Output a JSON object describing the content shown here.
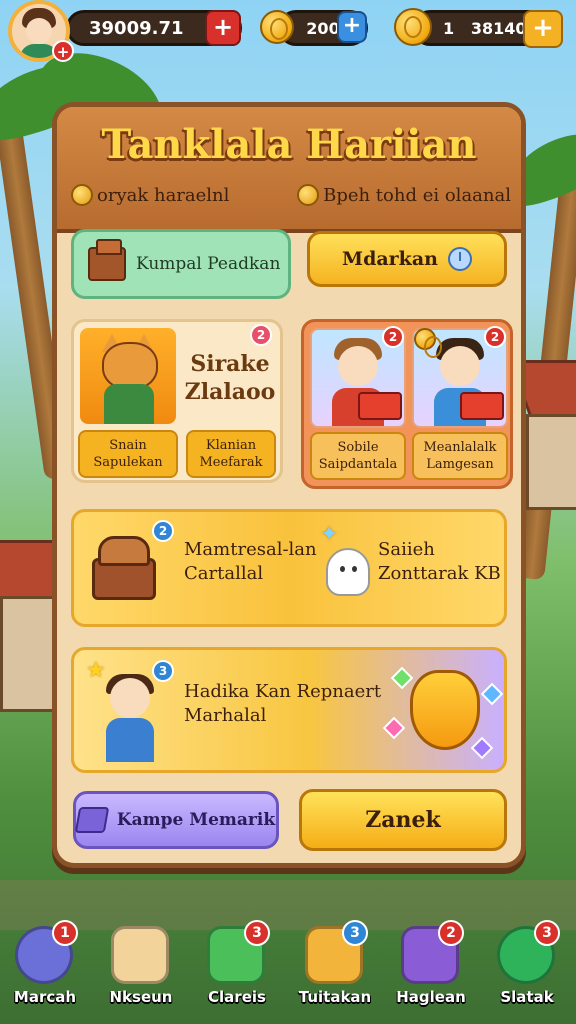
{
  "top_bar": {
    "player_value": "39009.71",
    "mid_currency": "200",
    "right_currency": "1   38140"
  },
  "panel": {
    "title": "Tanklala Hariian",
    "subtitle_left": "oryak haraelnl",
    "subtitle_right": "Bpeh tohd ei olaanal",
    "left_button": "Kumpal Peadkan",
    "right_button": "Mdarkan",
    "card_left": {
      "title_line1": "Sirake",
      "title_line2": "Zlalaoo",
      "badge": "2",
      "chip1_line1": "Snain",
      "chip1_line2": "Sapulekan",
      "chip2_line1": "Klanian",
      "chip2_line2": "Meefarak"
    },
    "card_right": {
      "badge1": "2",
      "badge2": "2",
      "chip1_line1": "Sobile",
      "chip1_line2": "Saipdantala",
      "chip2_line1": "Meanlalalk",
      "chip2_line2": "Lamgesan"
    },
    "card_wide1": {
      "badge": "2",
      "left_line1": "Mamtresal-lan",
      "left_line2": "Cartallal",
      "right_line1": "Saiieh",
      "right_line2": "Zonttarak KB"
    },
    "card_wide2": {
      "badge": "3",
      "line1": "Hadika Kan Repnaert",
      "line2": "Marhalal"
    },
    "bottom_left_button": "Kampe Memarik",
    "bottom_right_button": "Zanek"
  },
  "nav": [
    {
      "label": "Marcah",
      "badge": "1",
      "icon": "globe-icon",
      "color": "#6b6fd8"
    },
    {
      "label": "Nkseun",
      "badge": "",
      "icon": "box-icon",
      "color": "#f2d49a"
    },
    {
      "label": "Clareis",
      "badge": "3",
      "icon": "card-icon",
      "color": "#4bbf5a"
    },
    {
      "label": "Tuitakan",
      "badge": "3",
      "icon": "gift-icon",
      "color": "#f2b43a"
    },
    {
      "label": "Haglean",
      "badge": "2",
      "icon": "gems-icon",
      "color": "#8a5cd6"
    },
    {
      "label": "Slatak",
      "badge": "3",
      "icon": "refresh-icon",
      "color": "#2fb35a"
    }
  ],
  "colors": {
    "panel": "#f2d9b0",
    "header": "#c97a3a",
    "title": "#ffd84a",
    "accent_yellow": "#f5b321",
    "badge_red": "#d8312c",
    "badge_blue": "#2f86d6"
  }
}
